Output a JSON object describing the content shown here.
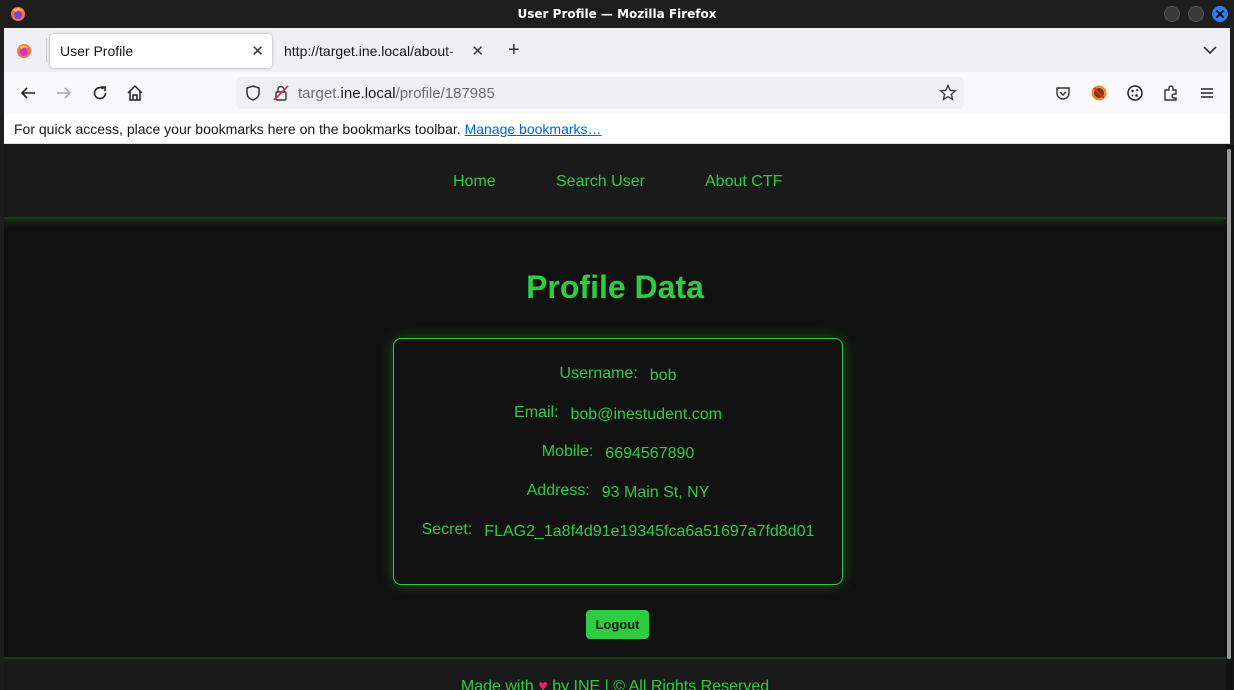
{
  "window": {
    "title": "User Profile — Mozilla Firefox"
  },
  "tabs": [
    {
      "label": "User Profile",
      "active": true
    },
    {
      "label": "http://target.ine.local/about-",
      "active": false
    }
  ],
  "urlbar": {
    "domain_dim_prefix": "target.",
    "domain": "ine.local",
    "path": "/profile/187985"
  },
  "bookmarks": {
    "message": "For quick access, place your bookmarks here on the bookmarks toolbar.",
    "link": "Manage bookmarks…"
  },
  "site": {
    "nav": [
      "Home",
      "Search User",
      "About CTF"
    ],
    "title": "Profile Data",
    "profile": [
      {
        "label": "Username:",
        "value": "bob"
      },
      {
        "label": "Email:",
        "value": "bob@inestudent.com"
      },
      {
        "label": "Mobile:",
        "value": "6694567890"
      },
      {
        "label": "Address:",
        "value": "93 Main St, NY"
      },
      {
        "label": "Secret:",
        "value": "FLAG2_1a8f4d91e19345fca6a51697a7fd8d01"
      }
    ],
    "logout_label": "Logout",
    "footer": {
      "before": "Made with",
      "heart": "♥",
      "after": "by INE | © All Rights Reserved"
    }
  },
  "colors": {
    "accent": "#2ecc40",
    "background": "#111111",
    "heart": "#e0245e"
  }
}
